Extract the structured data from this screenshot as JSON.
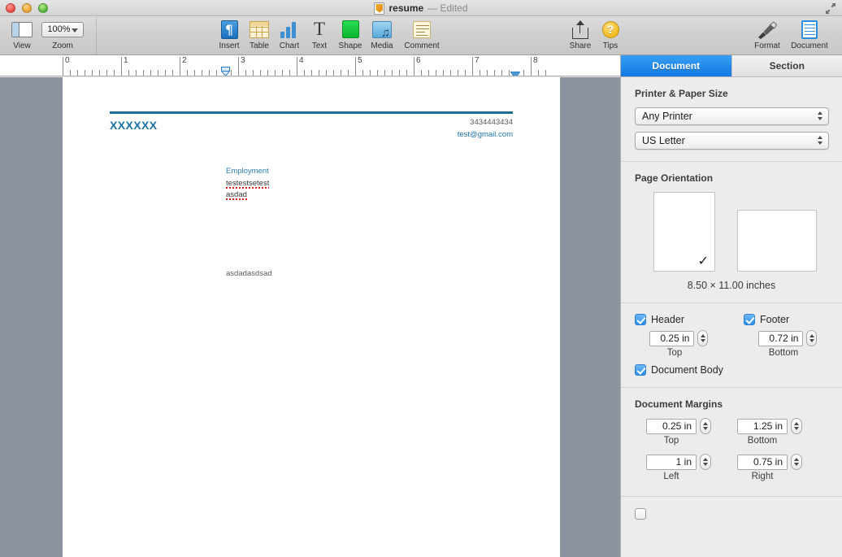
{
  "window": {
    "title": "resume",
    "edited_label": "— Edited",
    "doc_icon": "pages-document-icon",
    "fullscreen_icon": "fullscreen-arrows-icon",
    "traffic_lights": [
      "close-button",
      "minimize-button",
      "zoom-button"
    ]
  },
  "toolbar": {
    "items": [
      {
        "label": "View",
        "icon": "view-sidebar-icon"
      },
      {
        "label": "Zoom",
        "icon": "zoom-popup-icon",
        "value": "100%"
      },
      {
        "label": "Insert",
        "icon": "insert-paragraph-icon"
      },
      {
        "label": "Table",
        "icon": "table-icon"
      },
      {
        "label": "Chart",
        "icon": "bar-chart-icon"
      },
      {
        "label": "Text",
        "icon": "text-box-icon"
      },
      {
        "label": "Shape",
        "icon": "shape-icon"
      },
      {
        "label": "Media",
        "icon": "media-icon"
      },
      {
        "label": "Comment",
        "icon": "comment-icon"
      },
      {
        "label": "Share",
        "icon": "share-upload-icon"
      },
      {
        "label": "Tips",
        "icon": "question-mark-icon"
      },
      {
        "label": "Format",
        "icon": "format-brush-icon"
      },
      {
        "label": "Document",
        "icon": "document-inspector-icon"
      }
    ]
  },
  "ruler": {
    "numbers": [
      "0",
      "1",
      "2",
      "3",
      "4",
      "5",
      "6",
      "7",
      "8"
    ],
    "left_indent_marker": "left-indent-marker",
    "right_indent_marker": "right-indent-marker"
  },
  "document": {
    "header_name": "XXXXXX",
    "phone": "3434443434",
    "email": "test@gmail.com",
    "section_title": "Employment",
    "body_lines": [
      "testestsetest",
      "asdad"
    ],
    "free_text": "asdadasdsad",
    "accent_color": "#1b73a4",
    "rule_color": "#1e6f96"
  },
  "inspector": {
    "tabs": [
      {
        "label": "Document",
        "active": true
      },
      {
        "label": "Section",
        "active": false
      }
    ],
    "printer_paper": {
      "heading": "Printer & Paper Size",
      "printer": "Any Printer",
      "paper_size": "US Letter"
    },
    "page_orientation": {
      "heading": "Page Orientation",
      "portrait_selected": true,
      "landscape_selected": false,
      "check_glyph": "✓",
      "dimensions": "8.50 × 11.00 inches"
    },
    "header_footer": {
      "header": {
        "label": "Header",
        "checked": true,
        "value": "0.25 in",
        "caption": "Top"
      },
      "footer": {
        "label": "Footer",
        "checked": true,
        "value": "0.72 in",
        "caption": "Bottom"
      },
      "document_body": {
        "label": "Document Body",
        "checked": true
      }
    },
    "margins": {
      "heading": "Document Margins",
      "fields": [
        {
          "value": "0.25 in",
          "caption": "Top"
        },
        {
          "value": "1.25 in",
          "caption": "Bottom"
        },
        {
          "value": "1 in",
          "caption": "Left"
        },
        {
          "value": "0.75 in",
          "caption": "Right"
        }
      ]
    }
  }
}
